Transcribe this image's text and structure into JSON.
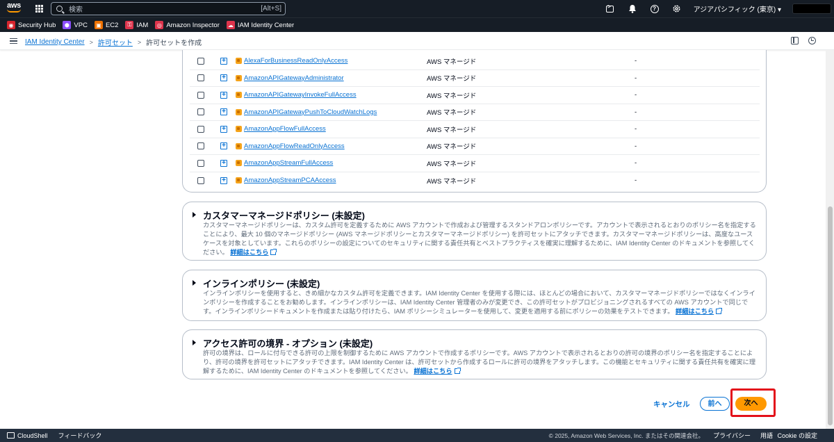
{
  "topnav": {
    "logo_text": "aws",
    "search_placeholder": "検索",
    "search_shortcut": "[Alt+S]",
    "region": "アジアパシフィック (東京) ▾",
    "icons": [
      "cloudshell-icon",
      "bell-icon",
      "help-icon",
      "settings-icon"
    ]
  },
  "favorites": [
    {
      "label": "Security Hub",
      "color": "#d6242d",
      "glyph": "◉"
    },
    {
      "label": "VPC",
      "color": "#8c4fff",
      "glyph": "⬢"
    },
    {
      "label": "EC2",
      "color": "#ed7100",
      "glyph": "▣"
    },
    {
      "label": "IAM",
      "color": "#dd344c",
      "glyph": "⚿"
    },
    {
      "label": "Amazon Inspector",
      "color": "#dd344c",
      "glyph": "◎"
    },
    {
      "label": "IAM Identity Center",
      "color": "#dd344c",
      "glyph": "☁"
    }
  ],
  "breadcrumb": {
    "items": [
      "IAM Identity Center",
      "許可セット"
    ],
    "current": "許可セットを作成"
  },
  "policies": [
    {
      "name": "AlexaForBusinessReadOnlyAccess",
      "type": "AWS マネージド",
      "description": "-"
    },
    {
      "name": "AmazonAPIGatewayAdministrator",
      "type": "AWS マネージド",
      "description": "-"
    },
    {
      "name": "AmazonAPIGatewayInvokeFullAccess",
      "type": "AWS マネージド",
      "description": "-"
    },
    {
      "name": "AmazonAPIGatewayPushToCloudWatchLogs",
      "type": "AWS マネージド",
      "description": "-"
    },
    {
      "name": "AmazonAppFlowFullAccess",
      "type": "AWS マネージド",
      "description": "-"
    },
    {
      "name": "AmazonAppFlowReadOnlyAccess",
      "type": "AWS マネージド",
      "description": "-"
    },
    {
      "name": "AmazonAppStreamFullAccess",
      "type": "AWS マネージド",
      "description": "-"
    },
    {
      "name": "AmazonAppStreamPCAAccess",
      "type": "AWS マネージド",
      "description": "-"
    }
  ],
  "sections": {
    "customer": {
      "title": "カスタマーマネージドポリシー (未設定)",
      "description": "カスタマーマネージドポリシーは、カスタム許可を定義するために AWS アカウントで作成および管理するスタンドアロンポリシーです。アカウントで表示されるとおりのポリシー名を指定することにより、最大 10 個のマネージドポリシー (AWS マネージドポリシーとカスタマーマネージドポリシー) を許可セットにアタッチできます。カスタマーマネージドポリシーは、高度なユースケースを対象としています。これらのポリシーの設定についてのセキュリティに関する責任共有とベストプラクティスを確実に理解するために、IAM Identity Center のドキュメントを参照してください。",
      "link": "詳細はこちら"
    },
    "inline": {
      "title": "インラインポリシー (未設定)",
      "description": "インラインポリシーを使用すると、きめ細かなカスタム許可を定義できます。IAM Identity Center を使用する際には、ほとんどの場合において、カスタマーマネージドポリシーではなくインラインポリシーを作成することをお勧めします。インラインポリシーは、IAM Identity Center 管理者のみが変更でき、この許可セットがプロビジョニングされるすべての AWS アカウントで同じです。インラインポリシードキュメントを作成または貼り付けたら、IAM ポリシーシミュレーターを使用して、変更を適用する前にポリシーの効果をテストできます。",
      "link": "詳細はこちら"
    },
    "boundary": {
      "title": "アクセス許可の境界 - オプション (未設定)",
      "description": "許可の境界は、ロールに付与できる許可の上限を制御するために AWS アカウントで作成するポリシーです。AWS アカウントで表示されるとおりの許可の境界のポリシー名を指定することにより、許可の境界を許可セットにアタッチできます。IAM Identity Center は、許可セットから作成するロールに許可の境界をアタッチします。この機能とセキュリティに関する責任共有を確実に理解するために、IAM Identity Center のドキュメントを参照してください。",
      "link": "詳細はこちら"
    }
  },
  "actions": {
    "cancel": "キャンセル",
    "previous": "前へ",
    "next": "次へ"
  },
  "footer": {
    "cloudshell": "CloudShell",
    "feedback": "フィードバック",
    "copyright": "© 2025, Amazon Web Services, Inc. またはその関連会社。",
    "privacy": "プライバシー",
    "terms": "用語",
    "cookie": "Cookie の設定"
  },
  "colors": {
    "nav_bg": "#161d26",
    "link": "#0972d3",
    "primary_button": "#ff9900",
    "highlight": "#e3101a"
  }
}
